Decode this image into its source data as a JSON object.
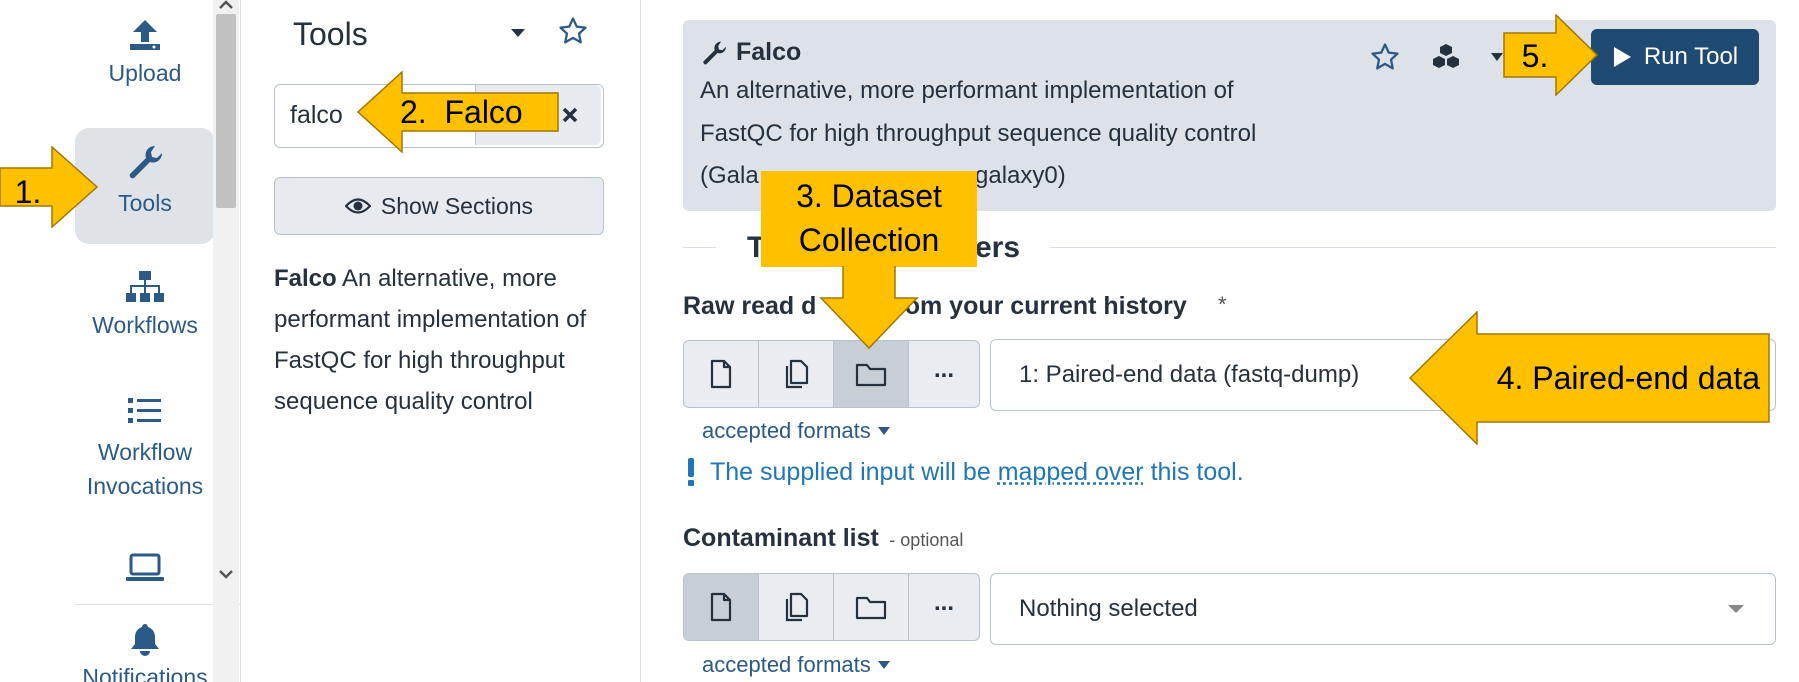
{
  "activity": {
    "items": [
      {
        "label": "Upload",
        "icon": "upload-icon"
      },
      {
        "label": "Tools",
        "icon": "wrench-icon"
      },
      {
        "label": "Workflows",
        "icon": "sitemap-icon"
      },
      {
        "label_line1": "Workflow",
        "label_line2": "Invocations",
        "icon": "list-icon"
      },
      {
        "label": "",
        "icon": "laptop-icon"
      },
      {
        "label": "Notifications",
        "icon": "bell-icon"
      }
    ]
  },
  "tools_panel": {
    "title": "Tools",
    "search_value": "falco",
    "show_sections_label": "Show Sections",
    "result_name": "Falco",
    "result_desc": "An alternative, more performant implementation of FastQC for high throughput sequence quality control"
  },
  "tool_form": {
    "tool_name": "Falco",
    "desc_line1": "An alternative, more performant implementation of",
    "desc_line2": "FastQC for high throughput sequence quality control",
    "desc_line3": "(Gala",
    "desc_line3b": "galaxy0)",
    "run_label": "Run Tool",
    "section_title_fragment1": "T",
    "section_title_fragment2": "ers",
    "input1": {
      "label_part1": "Raw read d",
      "label_part2": "rom your current history",
      "required_mark": "*",
      "value": "1: Paired-end data (fastq-dump)",
      "accepted_formats": "accepted formats",
      "mapped_msg_pre": "The supplied input will be",
      "mapped_link": "mapped over",
      "mapped_msg_post": "this tool."
    },
    "input2": {
      "label": "Contaminant list",
      "optional": "- optional",
      "value": "Nothing selected",
      "accepted_formats": "accepted formats"
    },
    "more_label": "..."
  },
  "annotations": {
    "a1": "1.",
    "a2": "2.  Falco",
    "a3_line1": "3. Dataset",
    "a3_line2": "Collection",
    "a4": "4. Paired-end data",
    "a5": "5."
  },
  "colors": {
    "callout": "#ffc000",
    "run_button": "#1f4a72",
    "header_bg": "#dce2e8",
    "link": "#2c5a87",
    "info_blue": "#2077b8"
  }
}
